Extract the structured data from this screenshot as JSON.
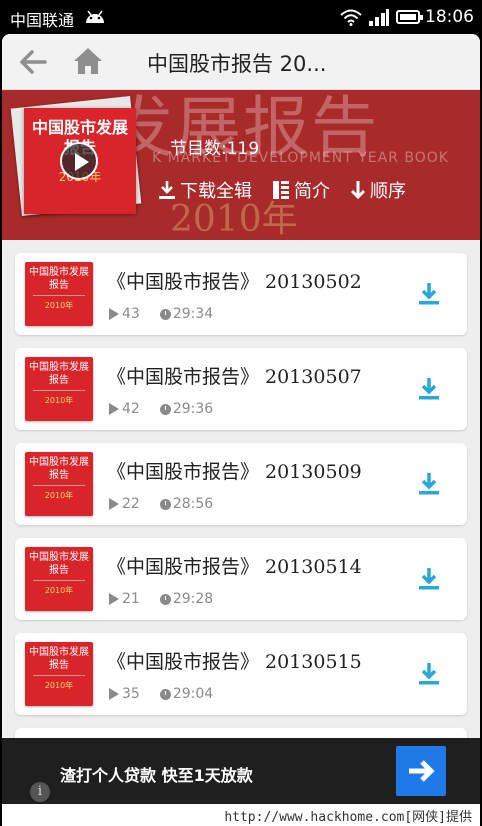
{
  "status_bar": {
    "carrier": "中国联通",
    "time": "18:06"
  },
  "topbar": {
    "title": "中国股市报告 20..."
  },
  "banner": {
    "background_title": "发展报告",
    "background_subtitle": "K MARKET DEVELOPMENT YEAR BOOK",
    "background_year": "2010年",
    "cover_title": "中国股市发展报告",
    "cover_year": "2010年",
    "episode_count": "节目数:119",
    "actions": {
      "download_all": "下载全辑",
      "intro": "简介",
      "order": "顺序"
    }
  },
  "episodes": [
    {
      "title": "《中国股市报告》 20130502",
      "plays": "43",
      "duration": "29:34"
    },
    {
      "title": "《中国股市报告》 20130507",
      "plays": "42",
      "duration": "29:36"
    },
    {
      "title": "《中国股市报告》 20130509",
      "plays": "22",
      "duration": "28:56"
    },
    {
      "title": "《中国股市报告》 20130514",
      "plays": "21",
      "duration": "29:28"
    },
    {
      "title": "《中国股市报告》 20130515",
      "plays": "35",
      "duration": "29:04"
    }
  ],
  "thumb": {
    "title": "中国股市发展报告",
    "year": "2010年"
  },
  "ad": {
    "text": "渣打个人贷款 快至1天放款",
    "info_glyph": "i"
  },
  "watermark": "http://www.hackhome.com[网侠]提供",
  "colors": {
    "banner": "#a92a2a",
    "cover": "#d9252a",
    "download_icon": "#29a8d8",
    "ad_button": "#1f7ae8"
  }
}
